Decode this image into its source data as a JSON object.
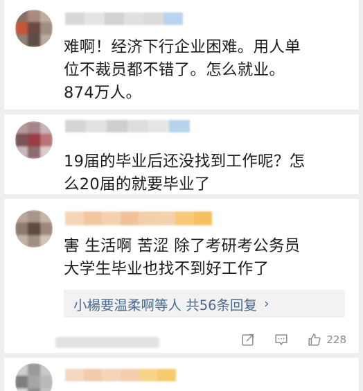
{
  "comments": [
    {
      "text": "难啊！经济下行企业困难。用人单\n位不裁员都不错了。怎么就业。\n874万人。"
    },
    {
      "text": "19届的毕业后还没找到工作呢？怎\n么20届的就要毕业了"
    },
    {
      "text": "害 生活啊 苦涩 除了考研考公务员\n大学生毕业也找不到好工作了",
      "replies_label": "小楊要温柔啊等人 共56条回复",
      "like_count": "228"
    }
  ],
  "icons": {
    "replies_chevron": "chevron-right-icon",
    "share": "share-icon",
    "comment": "comment-icon",
    "like": "thumbs-up-icon"
  },
  "colors": {
    "link": "#4a6a90",
    "text": "#1c1c1c",
    "meta": "#8a8a8a",
    "reply_bg": "#f2f2f2"
  }
}
